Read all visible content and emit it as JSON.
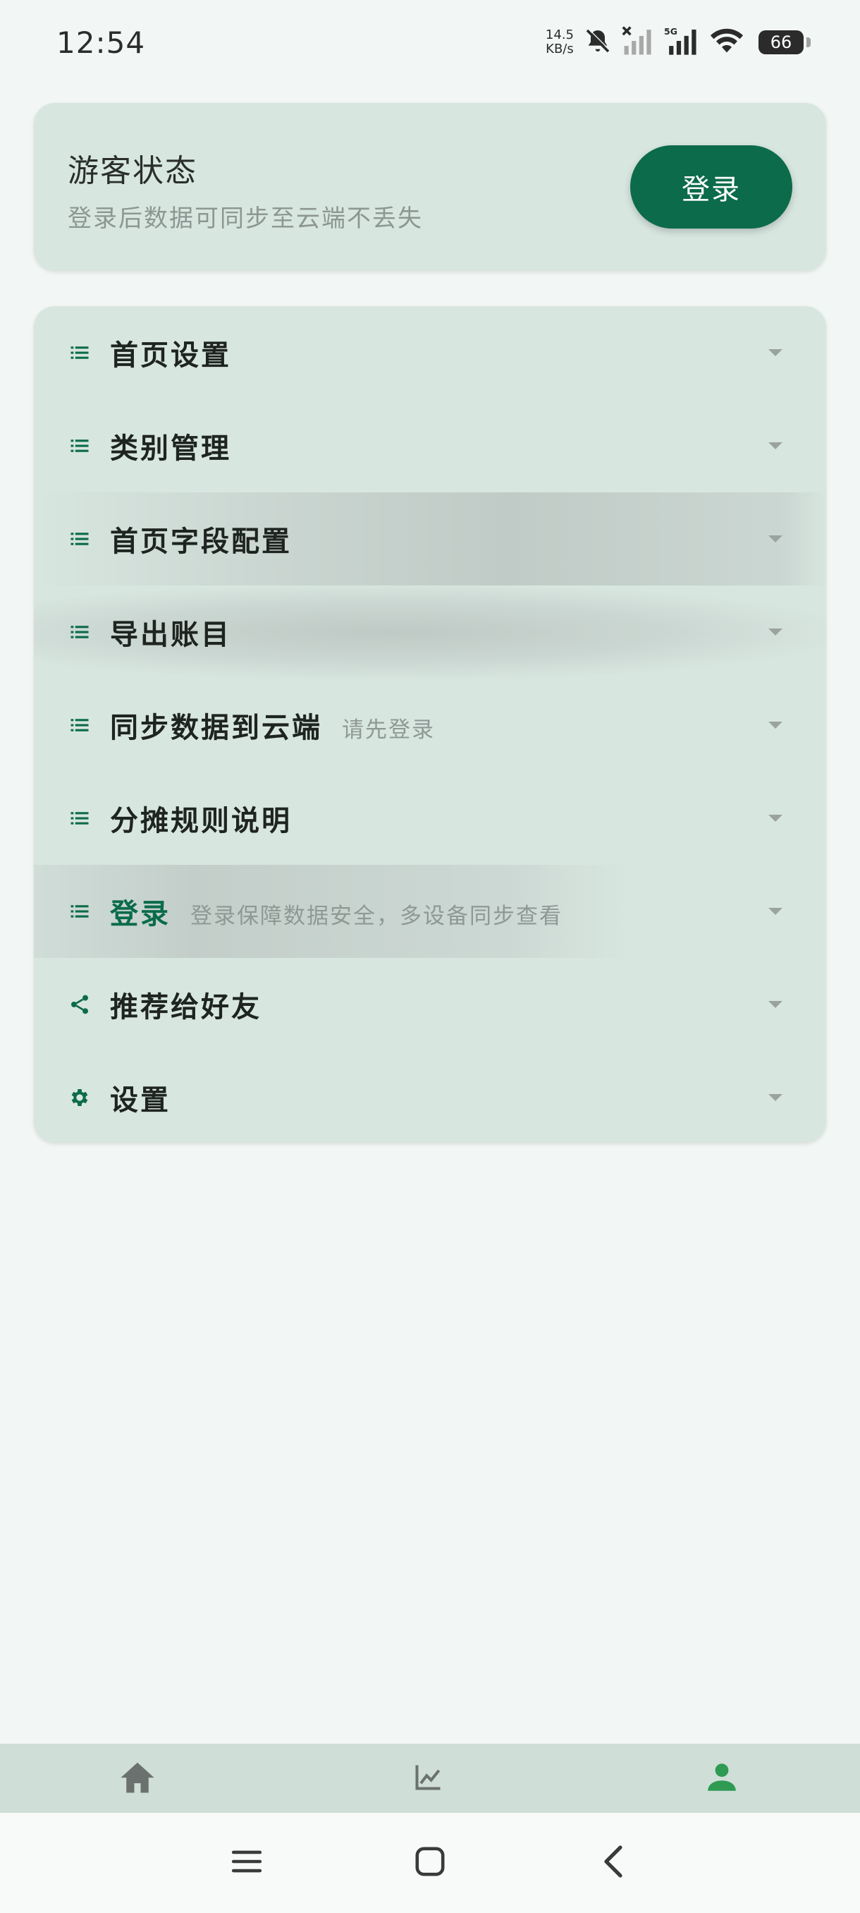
{
  "status_bar": {
    "time": "12:54",
    "net_speed_value": "14.5",
    "net_speed_unit": "KB/s",
    "network_label": "5G",
    "battery": "66"
  },
  "guest_card": {
    "title": "游客状态",
    "subtitle": "登录后数据可同步至云端不丢失",
    "login_button": "登录"
  },
  "menu": {
    "items": [
      {
        "label": "首页设置",
        "icon": "list-icon"
      },
      {
        "label": "类别管理",
        "icon": "list-icon"
      },
      {
        "label": "首页字段配置",
        "icon": "list-icon"
      },
      {
        "label": "导出账目",
        "icon": "list-icon"
      },
      {
        "label": "同步数据到云端",
        "sub": "请先登录",
        "icon": "list-icon"
      },
      {
        "label": "分摊规则说明",
        "icon": "list-icon"
      },
      {
        "label": "登录",
        "sub": "登录保障数据安全，多设备同步查看",
        "icon": "list-icon"
      },
      {
        "label": "推荐给好友",
        "icon": "share-icon"
      },
      {
        "label": "设置",
        "icon": "gear-icon"
      }
    ]
  },
  "bottom_nav": {
    "items": [
      {
        "icon": "home-icon",
        "active": false
      },
      {
        "icon": "chart-icon",
        "active": false
      },
      {
        "icon": "person-icon",
        "active": true
      }
    ]
  },
  "colors": {
    "accent": "#0B6B4A",
    "active_nav": "#2E9A52",
    "inactive_nav": "#6B716E",
    "card_bg": "#D8E6E0",
    "page_bg": "#F2F6F4"
  }
}
